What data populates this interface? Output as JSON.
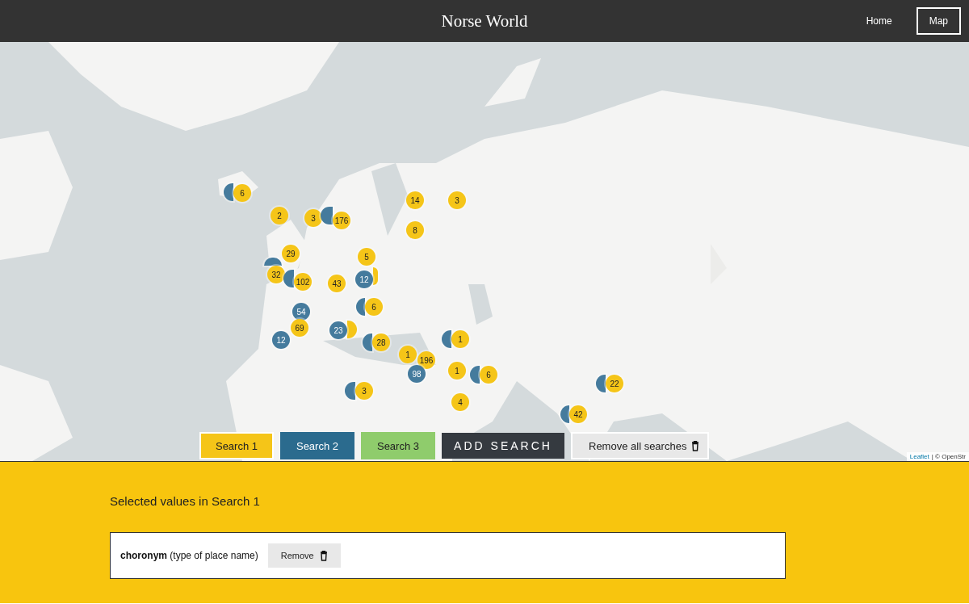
{
  "header": {
    "title": "Norse World",
    "nav": [
      {
        "label": "Home",
        "selected": false
      },
      {
        "label": "Map",
        "selected": true
      }
    ]
  },
  "map": {
    "markers": [
      {
        "color": "#457b9d"
      },
      {
        "color": "#f5c518",
        "label": "6"
      },
      {
        "color": "#f5c518",
        "label": "2"
      },
      {
        "color": "#f5c518",
        "label": "3"
      },
      {
        "color": "#457b9d"
      },
      {
        "color": "#f5c518",
        "label": "176"
      },
      {
        "color": "#f5c518",
        "label": "29"
      },
      {
        "color": "#457b9d"
      },
      {
        "color": "#f5c518",
        "label": "32"
      },
      {
        "color": "#457b9d"
      },
      {
        "color": "#f5c518",
        "label": "102"
      },
      {
        "color": "#f5c518",
        "label": "43"
      },
      {
        "color": "#f5c518",
        "label": "5"
      },
      {
        "color": "#f5c518"
      },
      {
        "color": "#457b9d",
        "label": "12"
      },
      {
        "color": "#f5c518",
        "label": "14"
      },
      {
        "color": "#f5c518",
        "label": "3"
      },
      {
        "color": "#f5c518",
        "label": "8"
      },
      {
        "color": "#457b9d",
        "label": "54"
      },
      {
        "color": "#457b9d"
      },
      {
        "color": "#f5c518",
        "label": "6"
      },
      {
        "color": "#f5c518",
        "label": "69"
      },
      {
        "color": "#457b9d",
        "label": "12"
      },
      {
        "color": "#f5c518"
      },
      {
        "color": "#457b9d",
        "label": "23"
      },
      {
        "color": "#457b9d"
      },
      {
        "color": "#f5c518",
        "label": "28"
      },
      {
        "color": "#457b9d"
      },
      {
        "color": "#f5c518",
        "label": "1"
      },
      {
        "color": "#f5c518",
        "label": "1"
      },
      {
        "color": "#f5c518",
        "label": "196"
      },
      {
        "color": "#f5c518",
        "label": "1"
      },
      {
        "color": "#457b9d",
        "label": "98"
      },
      {
        "color": "#457b9d"
      },
      {
        "color": "#f5c518",
        "label": "6"
      },
      {
        "color": "#457b9d"
      },
      {
        "color": "#f5c518",
        "label": "22"
      },
      {
        "color": "#457b9d"
      },
      {
        "color": "#f5c518",
        "label": "3"
      },
      {
        "color": "#f5c518",
        "label": "4"
      },
      {
        "color": "#457b9d"
      },
      {
        "color": "#f5c518",
        "label": "42"
      }
    ],
    "search_tabs": [
      {
        "label": "Search 1",
        "color": "#f5c518",
        "selected": true
      },
      {
        "label": "Search 2",
        "color": "#2b6b8e",
        "selected": false
      },
      {
        "label": "Search 3",
        "color": "#8fcc6c",
        "selected": false
      }
    ],
    "add_button": "ADD SEARCH",
    "remove_all_button": "Remove all searches",
    "attribution": {
      "link": "Leaflet",
      "text": "| © OpenStr"
    }
  },
  "panel": {
    "heading": "Selected values in Search 1",
    "values": [
      {
        "text": "**choronym** (type of place name)",
        "button": "Remove"
      }
    ]
  }
}
